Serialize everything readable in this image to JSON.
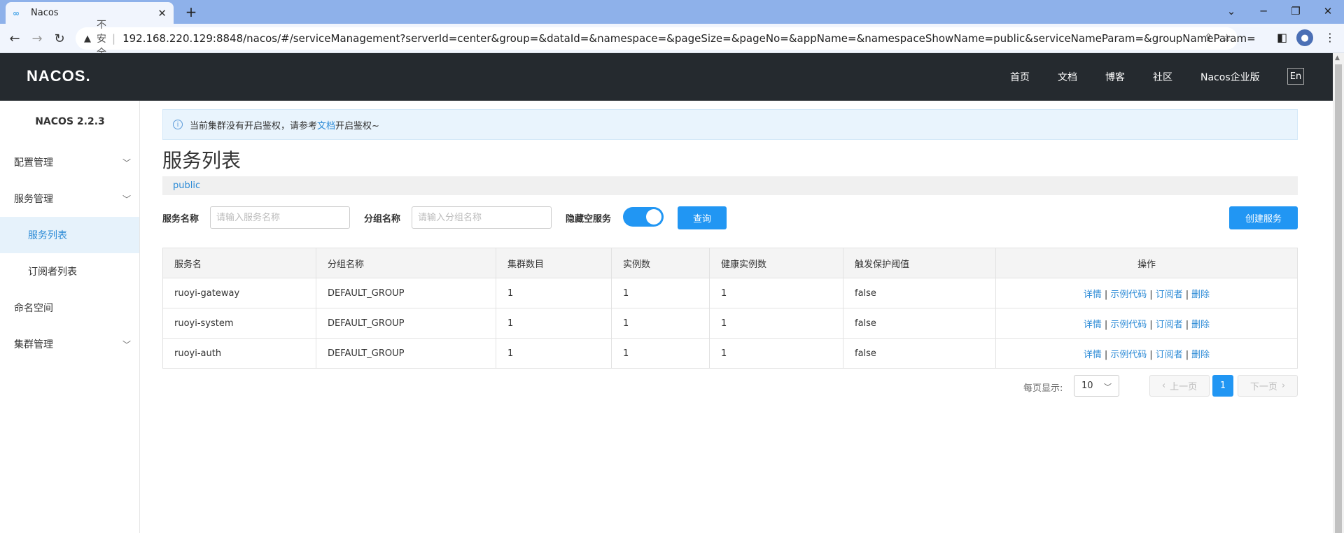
{
  "browser": {
    "tab_title": "Nacos",
    "tab_favicon": "∞",
    "close_glyph": "✕",
    "newtab_glyph": "+",
    "insecure_label": "不安全",
    "url": "192.168.220.129:8848/nacos/#/serviceManagement?serverId=center&group=&dataId=&namespace=&pageSize=&pageNo=&appName=&namespaceShowName=public&serviceNameParam=&groupNameParam="
  },
  "topnav": {
    "logo": "NACOS.",
    "links": [
      "首页",
      "文档",
      "博客",
      "社区",
      "Nacos企业版"
    ],
    "lang": "En"
  },
  "sidebar": {
    "version": "NACOS 2.2.3",
    "items": [
      {
        "label": "配置管理"
      },
      {
        "label": "服务管理"
      },
      {
        "label": "服务列表"
      },
      {
        "label": "订阅者列表"
      },
      {
        "label": "命名空间"
      },
      {
        "label": "集群管理"
      }
    ]
  },
  "notice": {
    "prefix": "当前集群没有开启鉴权，请参考",
    "link": "文档",
    "suffix": "开启鉴权~"
  },
  "page": {
    "title": "服务列表",
    "namespace": "public"
  },
  "filters": {
    "service_label": "服务名称",
    "service_placeholder": "请输入服务名称",
    "group_label": "分组名称",
    "group_placeholder": "请输入分组名称",
    "hide_empty_label": "隐藏空服务",
    "hide_empty_on": true,
    "query_button": "查询",
    "create_button": "创建服务"
  },
  "table": {
    "columns": [
      "服务名",
      "分组名称",
      "集群数目",
      "实例数",
      "健康实例数",
      "触发保护阈值",
      "操作"
    ],
    "rows": [
      [
        "ruoyi-gateway",
        "DEFAULT_GROUP",
        "1",
        "1",
        "1",
        "false"
      ],
      [
        "ruoyi-system",
        "DEFAULT_GROUP",
        "1",
        "1",
        "1",
        "false"
      ],
      [
        "ruoyi-auth",
        "DEFAULT_GROUP",
        "1",
        "1",
        "1",
        "false"
      ]
    ],
    "operations": [
      "详情",
      "示例代码",
      "订阅者",
      "删除"
    ],
    "op_separator": "|"
  },
  "pagination": {
    "page_size_label": "每页显示:",
    "page_size": "10",
    "prev": "上一页",
    "current": "1",
    "next": "下一页"
  }
}
